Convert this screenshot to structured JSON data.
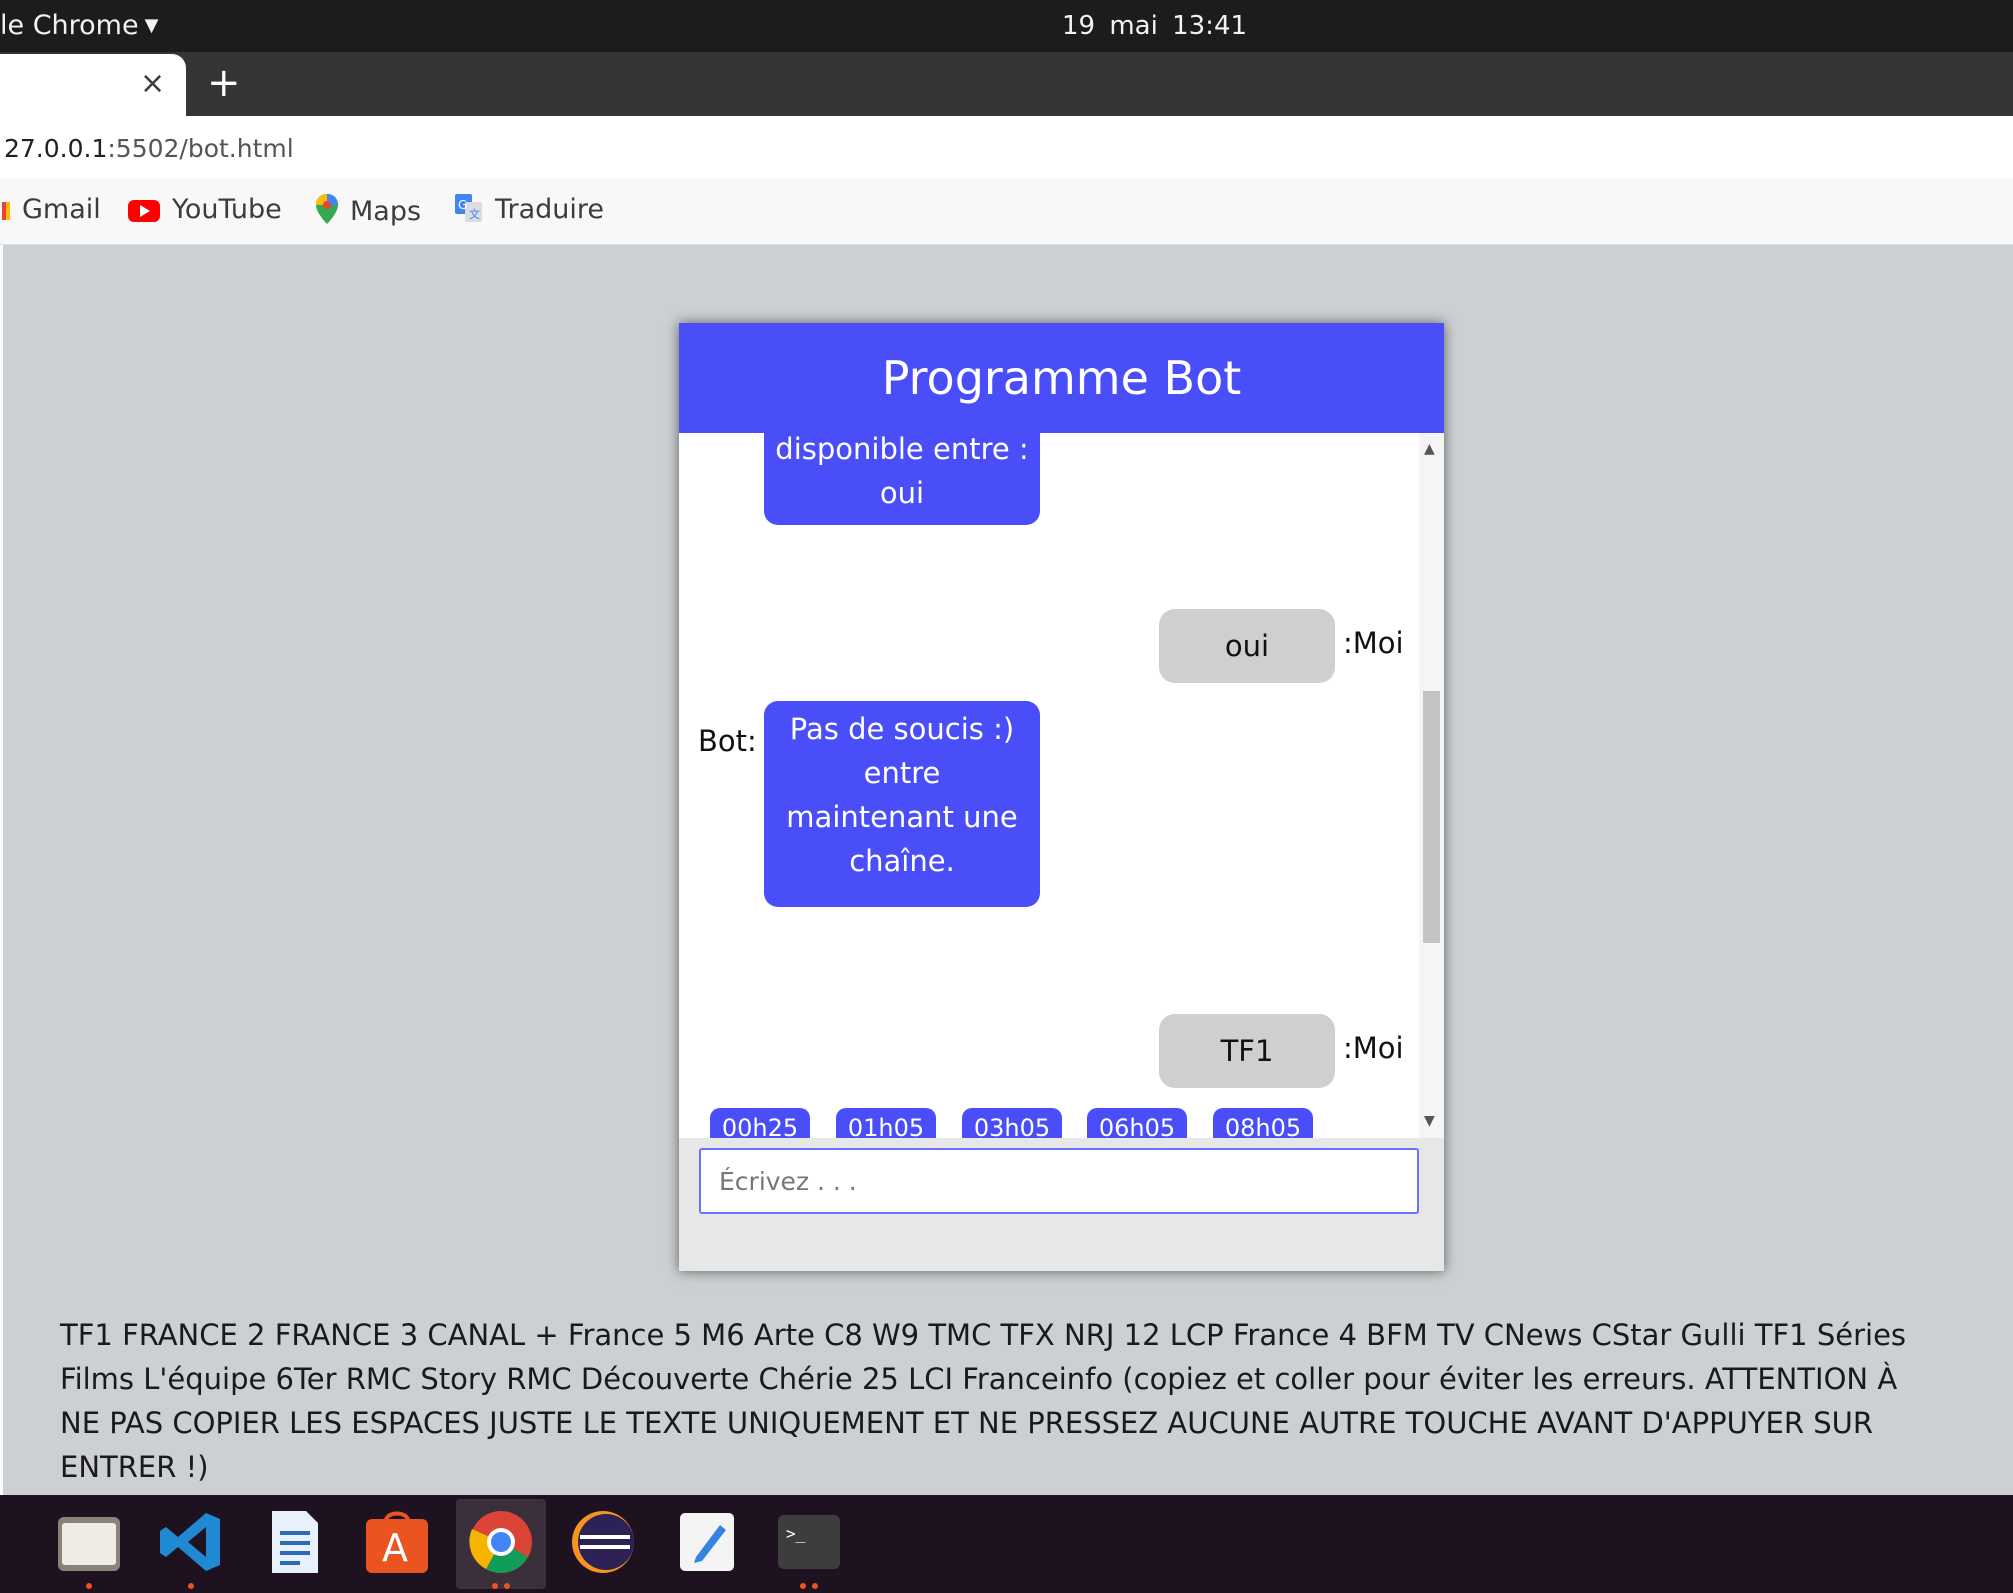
{
  "topbar": {
    "app_menu": "le Chrome",
    "clock": "19 mai  13:41"
  },
  "tabs": {
    "close_symbol": "×",
    "new_tab_symbol": "+"
  },
  "address": {
    "host": "27.0.0.1",
    "rest": ":5502/bot.html"
  },
  "bookmarks": [
    {
      "label": "Gmail",
      "icon": "gmail-icon"
    },
    {
      "label": "YouTube",
      "icon": "youtube-icon"
    },
    {
      "label": "Maps",
      "icon": "maps-icon"
    },
    {
      "label": "Traduire",
      "icon": "translate-icon"
    }
  ],
  "chat": {
    "title": "Programme Bot",
    "messages": [
      {
        "from": "bot",
        "text": "disponible entre : oui",
        "label": ""
      },
      {
        "from": "me",
        "text": "oui",
        "label": ":Moi"
      },
      {
        "from": "bot",
        "text": "Pas de soucis :) entre maintenant une chaîne.",
        "label": "Bot:"
      },
      {
        "from": "me",
        "text": "TF1",
        "label": ":Moi"
      }
    ],
    "time_chips": [
      "00h25",
      "01h05",
      "03h05",
      "06h05",
      "08h05"
    ],
    "input_placeholder": "Écrivez . . ."
  },
  "channel_list": "TF1 FRANCE 2 FRANCE 3 CANAL + France 5 M6 Arte C8 W9 TMC TFX NRJ 12 LCP France 4 BFM TV CNews CStar Gulli TF1 Séries Films L'équipe 6Ter RMC Story RMC Découverte Chérie 25 LCI Franceinfo (copiez et coller pour éviter les erreurs. ATTENTION À NE PAS COPIER LES ESPACES JUSTE LE TEXTE UNIQUEMENT ET NE PRESSEZ AUCUNE AUTRE TOUCHE AVANT D'APPUYER SUR ENTRER !)",
  "dock": [
    {
      "icon": "files-icon"
    },
    {
      "icon": "vscode-icon"
    },
    {
      "icon": "writer-icon"
    },
    {
      "icon": "software-center-icon"
    },
    {
      "icon": "chrome-icon"
    },
    {
      "icon": "eclipse-icon"
    },
    {
      "icon": "text-editor-icon"
    },
    {
      "icon": "terminal-icon"
    }
  ],
  "colors": {
    "accent": "#4a4ef8",
    "page_bg": "#ccd0d2",
    "user_bubble": "#cfcfcf"
  }
}
